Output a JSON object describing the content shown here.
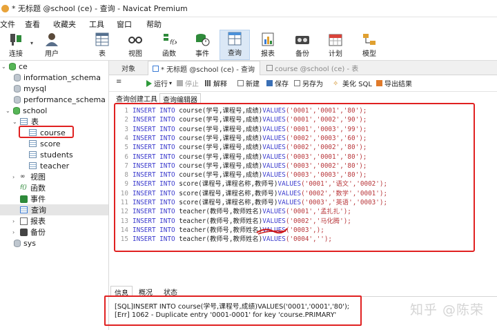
{
  "window": {
    "title": "* 无标题 @school (ce) - 查询 - Navicat Premium"
  },
  "menu": [
    "文件",
    "查看",
    "收藏夹",
    "工具",
    "窗口",
    "帮助"
  ],
  "toolbar": {
    "connect": "连接",
    "user": "用户",
    "table": "表",
    "view": "视图",
    "function": "函数",
    "event": "事件",
    "query": "查询",
    "report": "报表",
    "backup": "备份",
    "schedule": "计划",
    "model": "模型"
  },
  "sidebar": {
    "connection": "ce",
    "databases": [
      "information_schema",
      "mysql",
      "performance_schema"
    ],
    "school": "school",
    "tables_group": "表",
    "tables": [
      "course",
      "score",
      "students",
      "teacher"
    ],
    "views": "视图",
    "functions": "函数",
    "events": "事件",
    "queries": "查询",
    "reports": "报表",
    "backups": "备份",
    "sys": "sys"
  },
  "tabs": {
    "object": "对象",
    "active_query": "* 无标题 @school (ce) - 查询",
    "course_table": "course @school (ce) - 表"
  },
  "query_toolbar": {
    "run": "运行",
    "stop": "停止",
    "explain": "解释",
    "new": "新建",
    "save": "保存",
    "save_as": "另存为",
    "beautify": "美化 SQL",
    "export": "导出结果"
  },
  "subtabs": {
    "builder": "查询创建工具",
    "editor": "查询编辑器"
  },
  "sql_lines": [
    {
      "kw1": "INSERT INTO",
      "target": "course(学号,课程号,成绩)",
      "kw2": "VALUES",
      "vals": "('0001','0001','80');"
    },
    {
      "kw1": "INSERT INTO",
      "target": "course(学号,课程号,成绩)",
      "kw2": "VALUES",
      "vals": "('0001','0002','90');"
    },
    {
      "kw1": "INSERT INTO",
      "target": "course(学号,课程号,成绩)",
      "kw2": "VALUES",
      "vals": "('0001','0003','99');"
    },
    {
      "kw1": "INSERT INTO",
      "target": "course(学号,课程号,成绩)",
      "kw2": "VALUES",
      "vals": "('0002','0003','60');"
    },
    {
      "kw1": "INSERT INTO",
      "target": "course(学号,课程号,成绩)",
      "kw2": "VALUES",
      "vals": "('0002','0002','80');"
    },
    {
      "kw1": "INSERT INTO",
      "target": "course(学号,课程号,成绩)",
      "kw2": "VALUES",
      "vals": "('0003','0001','80');"
    },
    {
      "kw1": "INSERT INTO",
      "target": "course(学号,课程号,成绩)",
      "kw2": "VALUES",
      "vals": "('0003','0002','80');"
    },
    {
      "kw1": "INSERT INTO",
      "target": "course(学号,课程号,成绩)",
      "kw2": "VALUES",
      "vals": "('0003','0003','80');"
    },
    {
      "kw1": "INSERT INTO",
      "target": "score(课程号,课程名称,教师号)",
      "kw2": "VALUES",
      "vals": "('0001','语文','0002');"
    },
    {
      "kw1": "INSERT INTO",
      "target": "score(课程号,课程名称,教师号)",
      "kw2": "VALUES",
      "vals": "('0002','数学','0001');"
    },
    {
      "kw1": "INSERT INTO",
      "target": "score(课程号,课程名称,教师号)",
      "kw2": "VALUES",
      "vals": "('0003','英语','0003');"
    },
    {
      "kw1": "INSERT INTO",
      "target": "teacher(教师号,教师姓名)",
      "kw2": "VALUES",
      "vals": "('0001','孟扎扎');"
    },
    {
      "kw1": "INSERT INTO",
      "target": "teacher(教师号,教师姓名)",
      "kw2": "VALUES",
      "vals": "('0002','马化腾');"
    },
    {
      "kw1": "INSERT INTO",
      "target": "teacher(教师号,教师姓名)",
      "kw2": "VALUES",
      "vals": "('0003',);"
    },
    {
      "kw1": "INSERT INTO",
      "target": "teacher(教师号,教师姓名)",
      "kw2": "VALUES",
      "vals": "('0004','');"
    }
  ],
  "bottom_tabs": {
    "info": "信息",
    "overview": "概况",
    "status": "状态"
  },
  "messages": {
    "sql": "[SQL]INSERT INTO course(学号,课程号,成绩)VALUES('0001','0001','80');",
    "err": "[Err] 1062 - Duplicate entry '0001-0001' for key 'course.PRIMARY'"
  },
  "watermark": "知乎 @陈荣",
  "colors": {
    "accent": "#3a3acd",
    "string": "#b8363a",
    "highlight": "#e02020",
    "selected_tool": "#dbe8f6"
  }
}
